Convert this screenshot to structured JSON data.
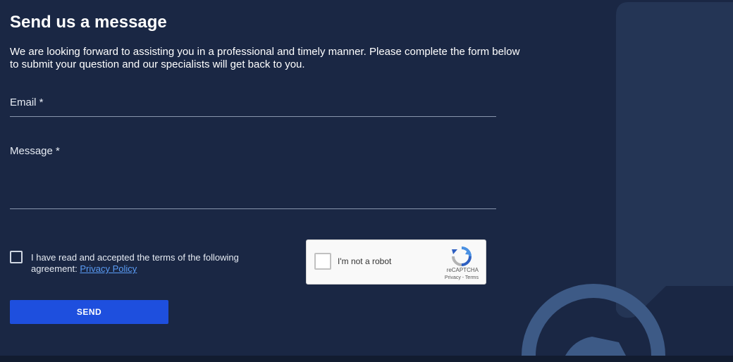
{
  "form": {
    "title": "Send us a message",
    "intro": "We are looking forward to assisting you in a professional and timely manner. Please complete the form below to submit your question and our specialists will get back to you.",
    "email_label": "Email *",
    "email_value": "",
    "message_label": "Message *",
    "message_value": "",
    "terms_text": "I have read and accepted the terms of the following agreement: ",
    "terms_link": "Privacy Policy",
    "terms_checked": false,
    "send_label": "SEND"
  },
  "captcha": {
    "label": "I'm not a robot",
    "brand": "reCAPTCHA",
    "links": "Privacy - Terms"
  },
  "colors": {
    "background": "#1a2744",
    "accent": "#1e4fde",
    "link": "#5a9cf5",
    "decoration": "#243555",
    "decoration_circle": "#3d5a86"
  },
  "icons": {
    "captcha_logo": "recaptcha-logo-icon",
    "decoration": "chat-bubble-illustration"
  }
}
